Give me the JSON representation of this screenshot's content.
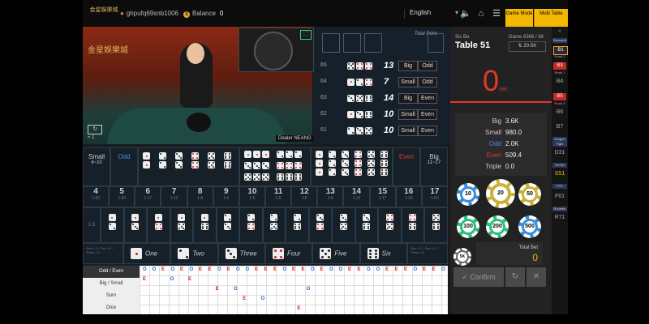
{
  "header": {
    "logo_text": "金星娛樂城",
    "username": "ghpufq69snb1006",
    "balance_label": "Balance",
    "balance_value": "0",
    "language": "English",
    "game_mode_label": "Game Mode",
    "multi_table_label": "Multi Table"
  },
  "video": {
    "overlay_logo": "金星娛樂城",
    "dealer_label": "Dealer NEANG",
    "signal": "1"
  },
  "results": {
    "total_point_label": "Total Point",
    "rows": [
      {
        "id": "65",
        "total": "13",
        "size": "Big",
        "parity": "Odd"
      },
      {
        "id": "64",
        "total": "7",
        "size": "Small",
        "parity": "Odd"
      },
      {
        "id": "63",
        "total": "14",
        "size": "Big",
        "parity": "Even"
      },
      {
        "id": "62",
        "total": "10",
        "size": "Small",
        "parity": "Even"
      },
      {
        "id": "61",
        "total": "10",
        "size": "Small",
        "parity": "Even"
      }
    ]
  },
  "table": {
    "game_type": "Sic Bo",
    "name": "Table 51",
    "game_no": "Game 6366 / 66",
    "limit": "20-5K",
    "countdown": "0",
    "countdown_unit": "sec"
  },
  "stats": [
    {
      "label": "Big",
      "value": "3.6K",
      "color": "#cccccc"
    },
    {
      "label": "Small",
      "value": "980.0",
      "color": "#cccccc"
    },
    {
      "label": "Odd",
      "value": "2.0K",
      "color": "#4a90e2"
    },
    {
      "label": "Even",
      "value": "509.4",
      "color": "#e03a2a"
    },
    {
      "label": "Triple",
      "value": "0.0",
      "color": "#cccccc"
    }
  ],
  "chips": [
    "10",
    "20",
    "50",
    "100",
    "200",
    "500",
    "5K"
  ],
  "total_bet": {
    "label": "Total Bet",
    "value": "0"
  },
  "actions": {
    "confirm": "Confirm"
  },
  "side_nav": {
    "baccarat": "Baccarat",
    "b1": "B1",
    "b3": "B3",
    "b4": "B4",
    "b5": "B5",
    "b6": "B6",
    "b7": "B7",
    "road1": "Road 1",
    "road2": "Road 2",
    "road3": "Road 3",
    "dragon_tiger": "Dragon Tiger",
    "d31": "D31",
    "sicbo": "Sic Bo",
    "s51": "S51",
    "fpc": "FPC",
    "f61": "F61",
    "roulette": "Roulette",
    "r71": "R71"
  },
  "board": {
    "small_label": "Small",
    "small_range": "4~10",
    "odd_label": "Odd",
    "even_label": "Even",
    "big_label": "Big",
    "big_range": "11~17",
    "numbers": [
      "4",
      "5",
      "6",
      "7",
      "8",
      "9",
      "10",
      "11",
      "12",
      "13",
      "14",
      "15",
      "16",
      "17"
    ],
    "number_payouts": [
      "1:60",
      "1:30",
      "1:17",
      "1:12",
      "1:8",
      "1:6",
      "1:6",
      "1:6",
      "1:6",
      "1:8",
      "1:12",
      "1:17",
      "1:30",
      "1:60"
    ],
    "combo_payout": "1:5",
    "face_payout_left": "One 1:1 / Two 1:2 / Three 1:3",
    "faces": [
      "One",
      "Two",
      "Three",
      "Four",
      "Five",
      "Six"
    ]
  },
  "road": {
    "tabs": [
      "Odd / Even",
      "Big / Small",
      "Sum",
      "Dice"
    ]
  }
}
